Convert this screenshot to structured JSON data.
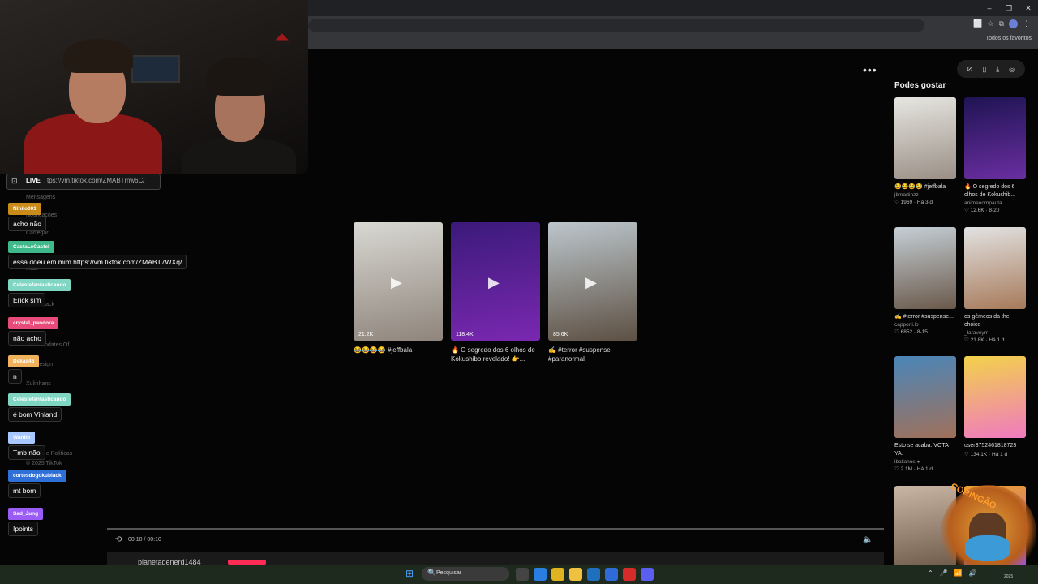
{
  "browser": {
    "window_controls": [
      "–",
      "❐",
      "✕"
    ],
    "toolbar_icons": [
      "⬜",
      "☆",
      "⧉",
      "⋮"
    ],
    "bookmarks_label": "Todos os favoritos"
  },
  "page": {
    "more_label": "•••",
    "top_pill_icons": [
      "⊘",
      "▯",
      "⤓",
      "◎"
    ],
    "videos": [
      {
        "views": "21.2K",
        "caption": "😂😂😂😂 #jeffbala",
        "colors": [
          "#d8d8d2",
          "#8f857c"
        ]
      },
      {
        "views": "118.4K",
        "caption": "🔥 O segredo dos 6 olhos de Kokushibo revelado! 👉...",
        "colors": [
          "#3b1a7a",
          "#7a28b0"
        ]
      },
      {
        "views": "85.6K",
        "caption": "✍️ #terror #suspense #paranormal",
        "colors": [
          "#bcc6cc",
          "#5d5043"
        ]
      }
    ],
    "player": {
      "time": "00:10 / 00:10",
      "username": "planetadenerd1484",
      "replay_icon": "⟲",
      "volume_icon": "🔈"
    }
  },
  "sidebar": {
    "title": "Podes gostar",
    "items": [
      {
        "caption": "😂😂😂😂 #jeffbala",
        "author": "jbmartinzz",
        "stats": "♡ 1969 · Há 3 d",
        "colors": [
          "#e6e6e0",
          "#9a8f86"
        ]
      },
      {
        "caption": "🔥 O segredo dos 6 olhos de Kokushib...",
        "author": "animeoompauta",
        "stats": "♡ 12.6K · 8-20",
        "colors": [
          "#1f1454",
          "#6a2ea0"
        ]
      },
      {
        "caption": "✍️ #terror #suspense...",
        "author": "capponi.lo",
        "stats": "♡ 6852 · 8-15",
        "colors": [
          "#c5cfd6",
          "#6a594a"
        ]
      },
      {
        "caption": "os gêmeos da the choice",
        "author": "_laraveyrr",
        "stats": "♡ 21.8K · Há 1 d",
        "colors": [
          "#e2e2e2",
          "#a77a5a"
        ]
      },
      {
        "caption": "Esto se acaba. VOTA YA.",
        "author": "iballanos ●",
        "stats": "♡ 2.1M · Há 1 d",
        "colors": [
          "#4a86b9",
          "#a0705a"
        ]
      },
      {
        "caption": "user3752461818723",
        "author": "",
        "stats": "♡ 134.1K · Há 1 d",
        "colors": [
          "#f2d24a",
          "#f07ac0"
        ]
      },
      {
        "caption": "",
        "author": "",
        "stats": "",
        "colors": [
          "#c9b6a5",
          "#6e5a49"
        ]
      },
      {
        "caption": "",
        "author": "",
        "stats": "",
        "colors": [
          "#f0a030",
          "#9c4fcf"
        ]
      }
    ]
  },
  "stream": {
    "live_label": "LIVE",
    "live_icon": "⊡",
    "live_url": "tps://vm.tiktok.com/ZMABTmw6C/",
    "ghost_nav": [
      "Mensagens",
      "Notificações",
      "Carregar",
      "Mais",
      "Goku black",
      "Terra Updates Of...",
      "joyydesign",
      "Xulinhans",
      "Termos e Políticas",
      "© 2025 TikTok"
    ],
    "chat": [
      {
        "name": "Nihilo001",
        "message": "acho não",
        "color": "#c98b1a"
      },
      {
        "name": "CastaLeCastel",
        "message": "essa doeu em mim https://vm.tiktok.com/ZMABT7WXq/",
        "color": "#3fb98c"
      },
      {
        "name": "Celestefantasticando",
        "message": "Erick sim",
        "color": "#7fd6c2"
      },
      {
        "name": "crystal_pandora",
        "message": "não acho",
        "color": "#e84a7a"
      },
      {
        "name": "Dekas46",
        "message": "n",
        "color": "#f0b25a"
      },
      {
        "name": "Celestefantasticando",
        "message": "é bom Vinland",
        "color": "#7fd6c2"
      },
      {
        "name": "Wanlin",
        "message": "Tmb não",
        "color": "#a8c8ff"
      },
      {
        "name": "cortesdogokublack",
        "message": "mt bom",
        "color": "#2e6fd8"
      },
      {
        "name": "Sad_Jung",
        "message": "!points",
        "color": "#9b5cf5"
      }
    ]
  },
  "taskbar": {
    "start_icon": "⊞",
    "search_icon": "🔍",
    "search_placeholder": "Pesquisar",
    "app_colors": [
      "#444",
      "#2a7de1",
      "#e0b420",
      "#f0c040",
      "#1f6fbf",
      "#2f6bd8",
      "#d62b2b",
      "#5a5ff0"
    ],
    "tray_icons": [
      "⌃",
      "🎤",
      "📶",
      "🔊"
    ],
    "date": "2025"
  },
  "overlay": {
    "sticker_text": "CORINGÃO"
  }
}
